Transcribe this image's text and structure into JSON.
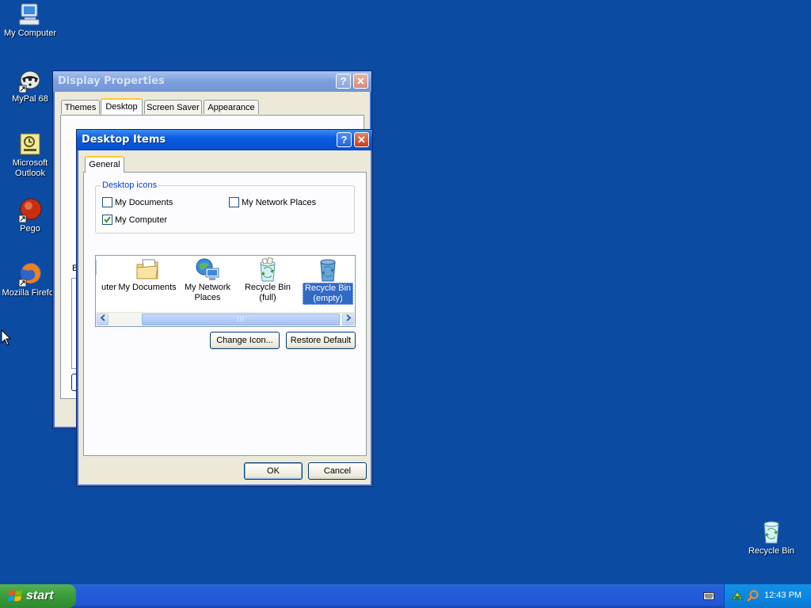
{
  "desktop": {
    "icons": [
      {
        "label": "My Computer"
      },
      {
        "label": "MyPal 68"
      },
      {
        "label": "Microsoft Outlook"
      },
      {
        "label": "Pego"
      },
      {
        "label": "Mozilla Firefox"
      },
      {
        "label": "Recycle Bin"
      }
    ]
  },
  "display_properties": {
    "title": "Display Properties",
    "tabs": [
      "Themes",
      "Desktop",
      "Screen Saver",
      "Appearance"
    ],
    "active_tab": "Desktop",
    "partial_label": "B"
  },
  "desktop_items": {
    "title": "Desktop Items",
    "tab": "General",
    "group_title": "Desktop icons",
    "checkboxes": [
      {
        "label": "My Documents",
        "checked": false
      },
      {
        "label": "My Network Places",
        "checked": false
      },
      {
        "label": "My Computer",
        "checked": true
      }
    ],
    "icon_list": [
      {
        "label_1": "uter",
        "label_2": "",
        "icon": "computer-icon"
      },
      {
        "label_1": "My Documents",
        "label_2": "",
        "icon": "folder-documents-icon"
      },
      {
        "label_1": "My Network",
        "label_2": "Places",
        "icon": "network-places-icon"
      },
      {
        "label_1": "Recycle Bin",
        "label_2": "(full)",
        "icon": "recycle-bin-full-icon"
      },
      {
        "label_1": "Recycle Bin",
        "label_2": "(empty)",
        "icon": "recycle-bin-empty-icon",
        "selected": true
      }
    ],
    "scroll_grip": "III",
    "change_icon_label": "Change Icon...",
    "restore_default_label": "Restore Default",
    "ok_label": "OK",
    "cancel_label": "Cancel",
    "help_label": "?",
    "close_label": "✕"
  },
  "taskbar": {
    "start_label": "start",
    "clock": "12:43 PM"
  },
  "colors": {
    "desktop_bg": "#0b4ba1",
    "title_active": "#0655d8",
    "selection": "#316ac5"
  }
}
